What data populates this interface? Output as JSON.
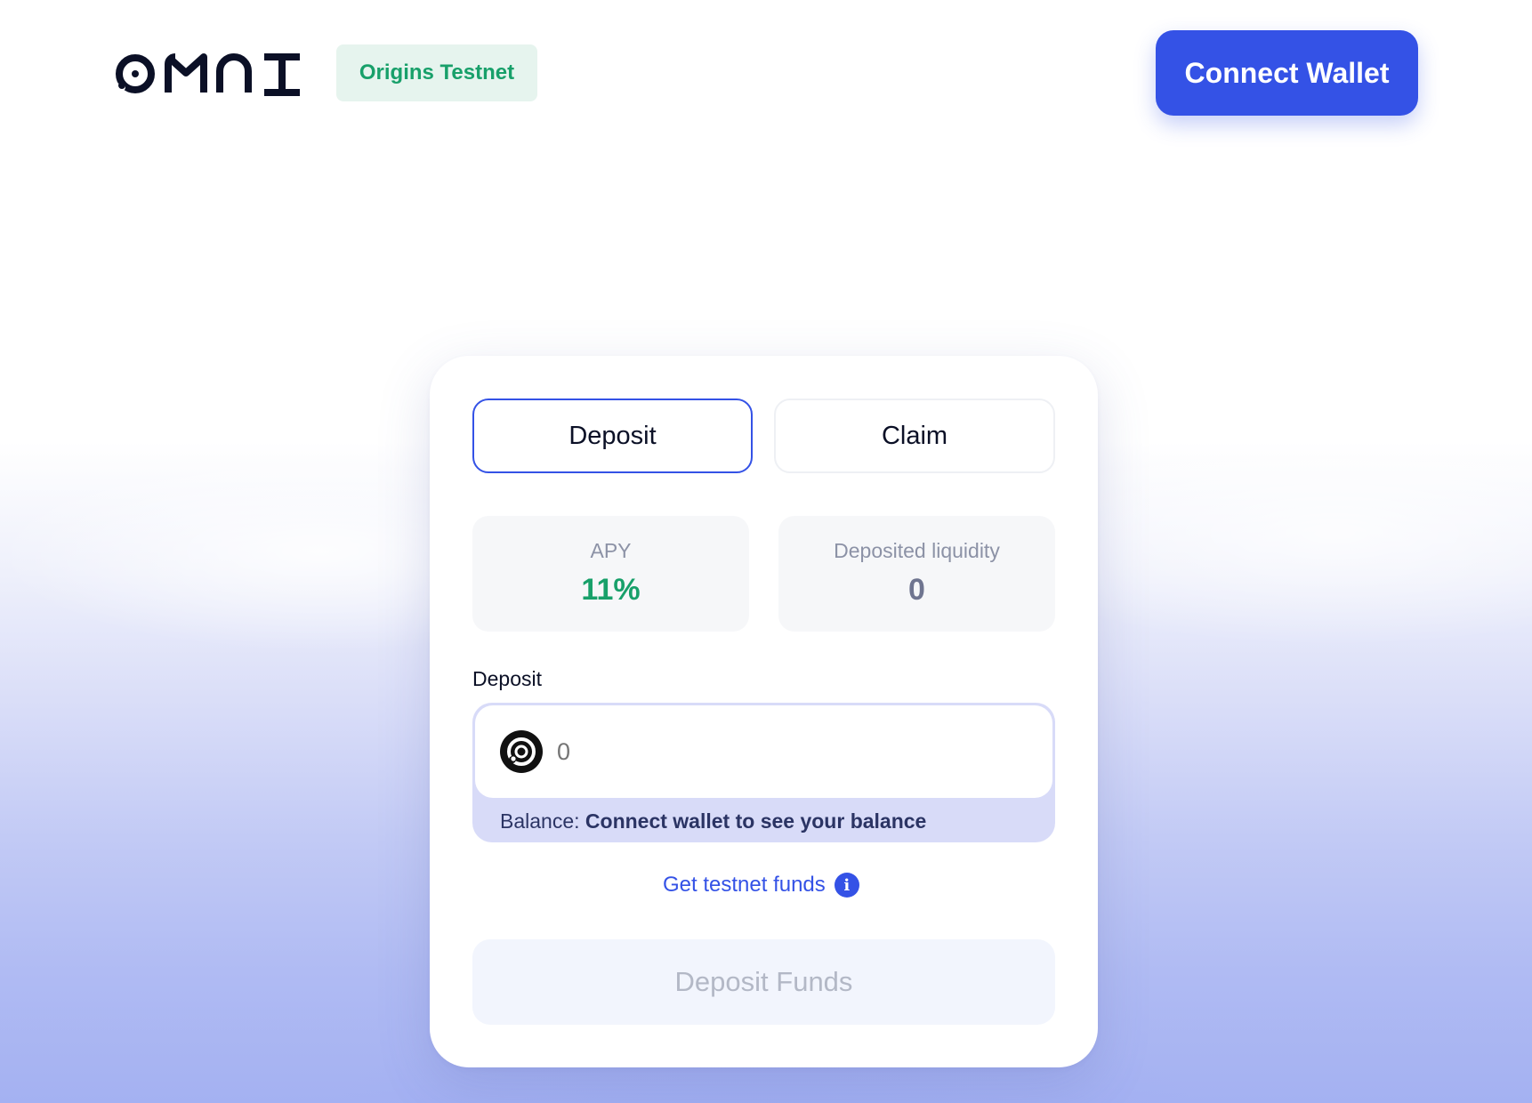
{
  "header": {
    "logo": "OMNI",
    "network_badge": "Origins Testnet",
    "connect_wallet_label": "Connect Wallet"
  },
  "tabs": [
    {
      "label": "Deposit",
      "active": true
    },
    {
      "label": "Claim",
      "active": false
    }
  ],
  "stats": {
    "apy_label": "APY",
    "apy_value": "11%",
    "liquidity_label": "Deposited liquidity",
    "liquidity_value": "0"
  },
  "deposit": {
    "section_label": "Deposit",
    "amount_placeholder": "0",
    "token_icon": "omni-token-icon",
    "balance_prefix": "Balance: ",
    "balance_value": "Connect wallet to see your balance"
  },
  "testnet_link": {
    "label": "Get testnet funds",
    "icon": "info-icon"
  },
  "submit": {
    "label": "Deposit Funds",
    "disabled": true
  },
  "colors": {
    "accent": "#3452e6",
    "success": "#18a06a",
    "badge_bg": "#e6f4ee"
  }
}
